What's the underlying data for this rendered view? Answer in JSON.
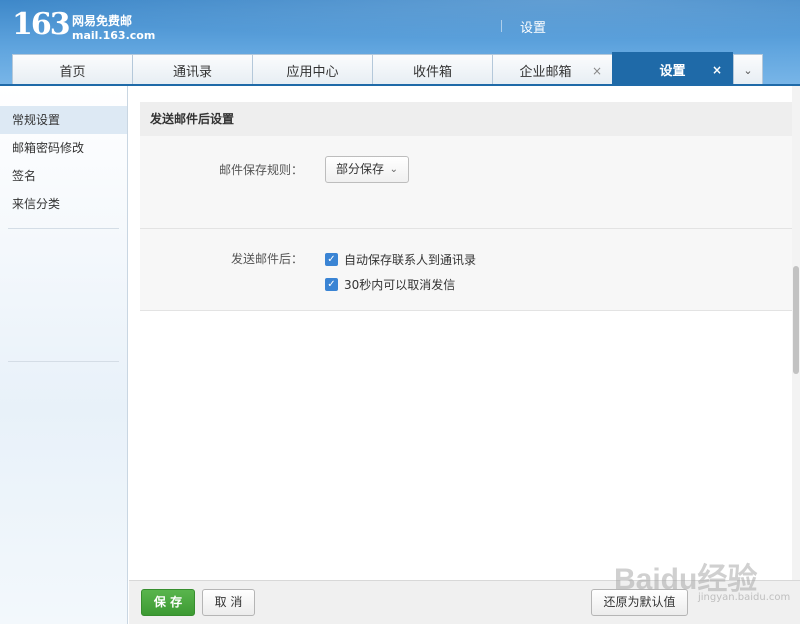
{
  "header": {
    "logo_number": "163",
    "logo_cn": "网易免费邮",
    "logo_domain": "mail.163.com",
    "title": "设置"
  },
  "tabs": [
    {
      "label": "首页",
      "closable": false,
      "active": false
    },
    {
      "label": "通讯录",
      "closable": false,
      "active": false
    },
    {
      "label": "应用中心",
      "closable": false,
      "active": false
    },
    {
      "label": "收件箱",
      "closable": false,
      "active": false
    },
    {
      "label": "企业邮箱",
      "closable": true,
      "active": false
    },
    {
      "label": "设置",
      "closable": true,
      "active": true
    }
  ],
  "tab_close_glyph": "×",
  "tab_more_glyph": "⌄",
  "sidebar": {
    "items": [
      {
        "label": "常规设置",
        "active": true
      },
      {
        "label": "邮箱密码修改",
        "active": false
      },
      {
        "label": "签名",
        "active": false
      },
      {
        "label": "来信分类",
        "active": false
      }
    ]
  },
  "main": {
    "section_title": "发送邮件后设置",
    "save_rule_label": "邮件保存规则：",
    "save_rule_value": "部分保存",
    "after_send_label": "发送邮件后：",
    "checkboxes": [
      {
        "label": "自动保存联系人到通讯录",
        "checked": true
      },
      {
        "label": "30秒内可以取消发信",
        "checked": true
      }
    ]
  },
  "footer": {
    "save_label": "保 存",
    "cancel_label": "取 消",
    "restore_label": "还原为默认值"
  },
  "watermark": {
    "text": "Baidu经验",
    "sub": "jingyan.baidu.com"
  },
  "colors": {
    "header_blue": "#3e88c9",
    "active_tab": "#1f6aa8",
    "save_green": "#3d9a33",
    "checkbox_blue": "#3a84d4"
  }
}
